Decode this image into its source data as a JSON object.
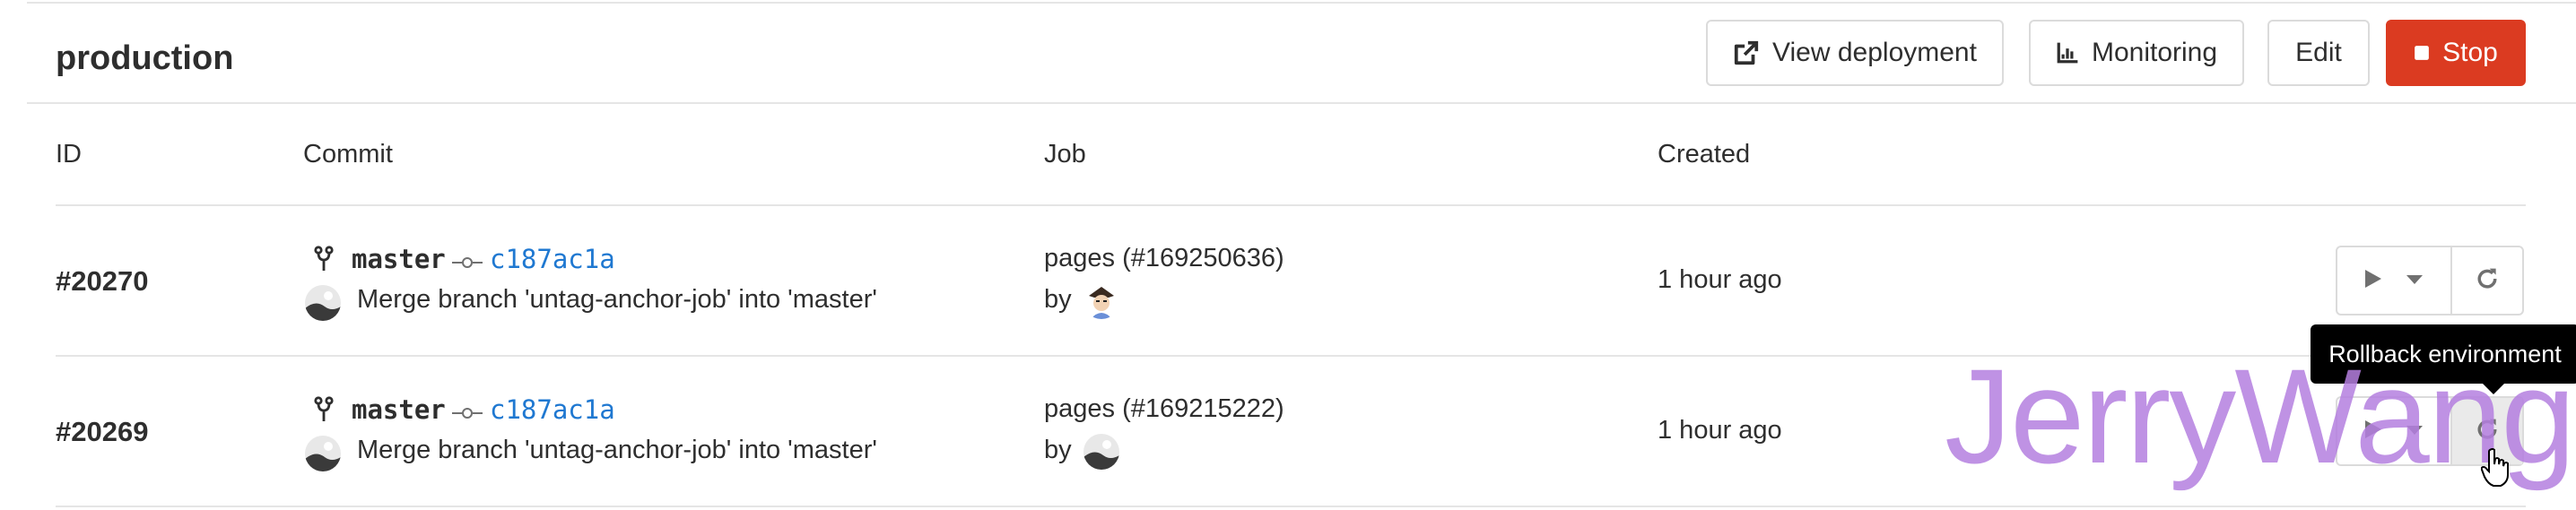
{
  "environment": {
    "name": "production"
  },
  "header_actions": {
    "view_deployment": "View deployment",
    "monitoring": "Monitoring",
    "edit": "Edit",
    "stop": "Stop",
    "stop_color": "#db3b21"
  },
  "table": {
    "columns": [
      "ID",
      "Commit",
      "Job",
      "Created"
    ],
    "rows": [
      {
        "id": "#20270",
        "branch": "master",
        "sha": "c187ac1a",
        "message": "Merge branch 'untag-anchor-job' into 'master'",
        "job": "pages (#169250636)",
        "by": "by",
        "created": "1 hour ago"
      },
      {
        "id": "#20269",
        "branch": "master",
        "sha": "c187ac1a",
        "message": "Merge branch 'untag-anchor-job' into 'master'",
        "job": "pages (#169215222)",
        "by": "by",
        "created": "1 hour ago"
      }
    ]
  },
  "tooltip": {
    "text": "Rollback environment"
  },
  "watermark": {
    "text": "JerryWang"
  },
  "colors": {
    "link": "#1f78d1",
    "border": "#dbdbdb",
    "text": "#2e2e2e"
  }
}
